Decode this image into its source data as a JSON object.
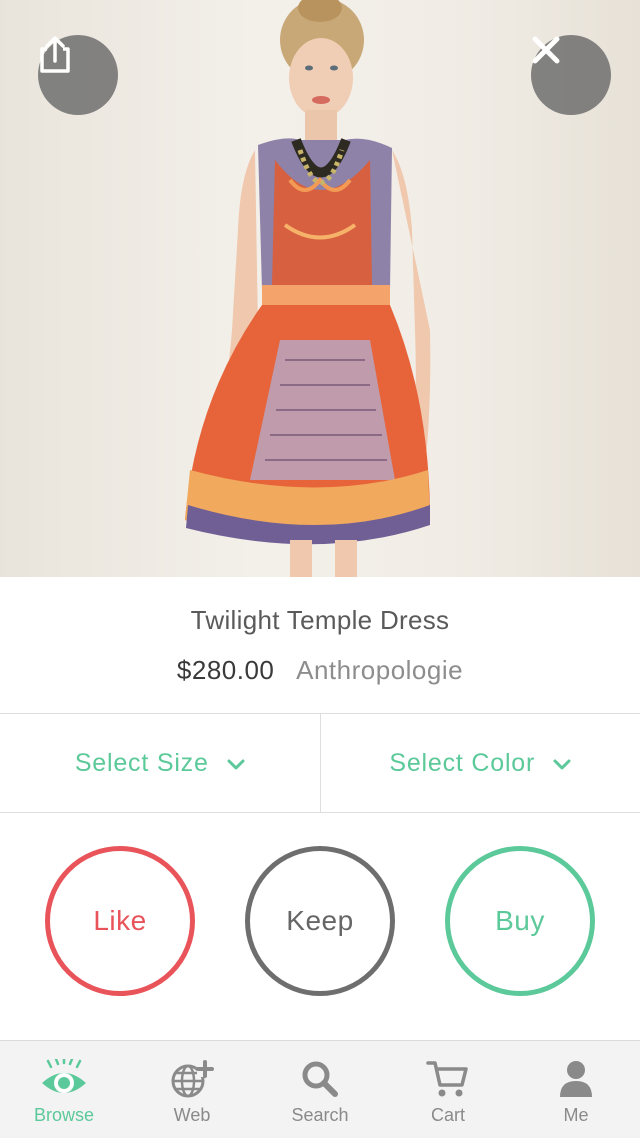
{
  "hero": {
    "share_icon": "share-icon",
    "close_icon": "close-icon",
    "image_icon": "dress-photo"
  },
  "product": {
    "name": "Twilight Temple Dress",
    "price": "$280.00",
    "brand": "Anthropologie"
  },
  "selectors": {
    "size_label": "Select Size",
    "color_label": "Select Color"
  },
  "actions": {
    "like_label": "Like",
    "keep_label": "Keep",
    "buy_label": "Buy"
  },
  "tabbar": {
    "items": [
      {
        "label": "Browse",
        "icon": "eye-icon",
        "active": true
      },
      {
        "label": "Web",
        "icon": "globe-plus-icon",
        "active": false
      },
      {
        "label": "Search",
        "icon": "search-icon",
        "active": false
      },
      {
        "label": "Cart",
        "icon": "cart-icon",
        "active": false
      },
      {
        "label": "Me",
        "icon": "user-icon",
        "active": false
      }
    ]
  },
  "colors": {
    "accent_green": "#5cc99a",
    "like_red": "#e8545a",
    "keep_gray": "#6e6e6e",
    "text_dark": "#3a3a3a",
    "text_muted": "#8d8d8d"
  }
}
